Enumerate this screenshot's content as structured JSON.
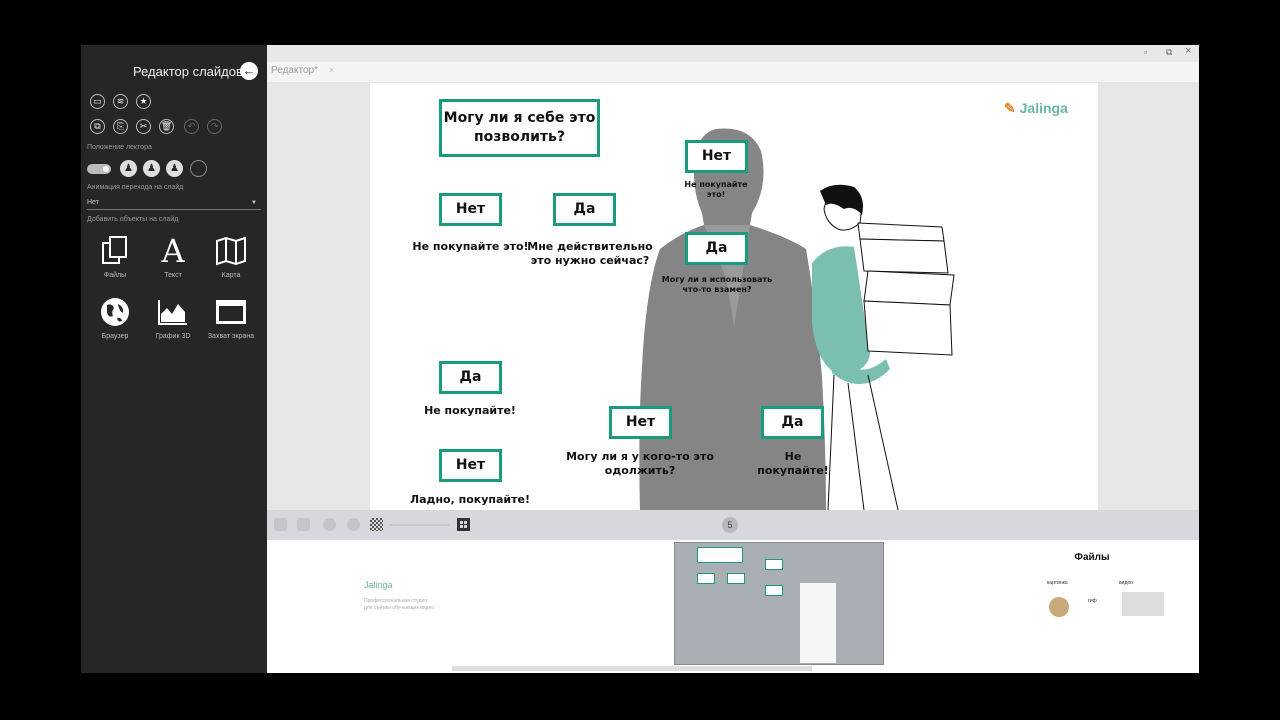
{
  "sidebar": {
    "title": "Редактор слайдов",
    "lecturer_label": "Положение лектора",
    "animation_label": "Анимация перехода на слайд",
    "animation_value": "Нет",
    "add_objects_label": "Добавить объекты на слайд",
    "objects": [
      {
        "label": "Файлы",
        "icon": "files-icon"
      },
      {
        "label": "Текст",
        "icon": "text-icon"
      },
      {
        "label": "Карта",
        "icon": "map-icon"
      },
      {
        "label": "Браузер",
        "icon": "globe-icon"
      },
      {
        "label": "График 3D",
        "icon": "chart-icon"
      },
      {
        "label": "Захват экрана",
        "icon": "screen-capture-icon"
      }
    ]
  },
  "tab": {
    "label": "Редактор*",
    "close": "×"
  },
  "window_controls": {
    "minimize": "▫",
    "restore": "⧉",
    "close": "×"
  },
  "slide": {
    "logo": "Jalinga",
    "logo_mark": "✎",
    "boxes": {
      "question": "Могу ли я себе это позволить?",
      "no1": "Нет",
      "yes1": "Да",
      "no2": "Нет",
      "yes2": "Да",
      "yes3": "Да",
      "no3": "Нет",
      "no4": "Нет",
      "yes4": "Да"
    },
    "texts": {
      "dont_buy": "Не покупайте это!",
      "really_need": "Мне действительно это нужно сейчас?",
      "dont_buy_small": "Не покупайте это!",
      "can_use": "Могу ли я использовать что-то взамен?",
      "dont_buy2": "Не покупайте!",
      "ok_buy": "Ладно, покупайте!",
      "borrow": "Могу ли я у кого-то это одолжить?",
      "dont_buy3": "Не покупайте!"
    }
  },
  "bottombar": {
    "page": "5"
  },
  "thumbnails": {
    "t1": {
      "logo": "Jalinga",
      "sub1": "Профессиональная студия",
      "sub2": "для съёмки обучающих видео"
    },
    "t3": {
      "title": "Файлы",
      "l1": "картинка",
      "l2": "гиф",
      "l3": "видео"
    }
  }
}
